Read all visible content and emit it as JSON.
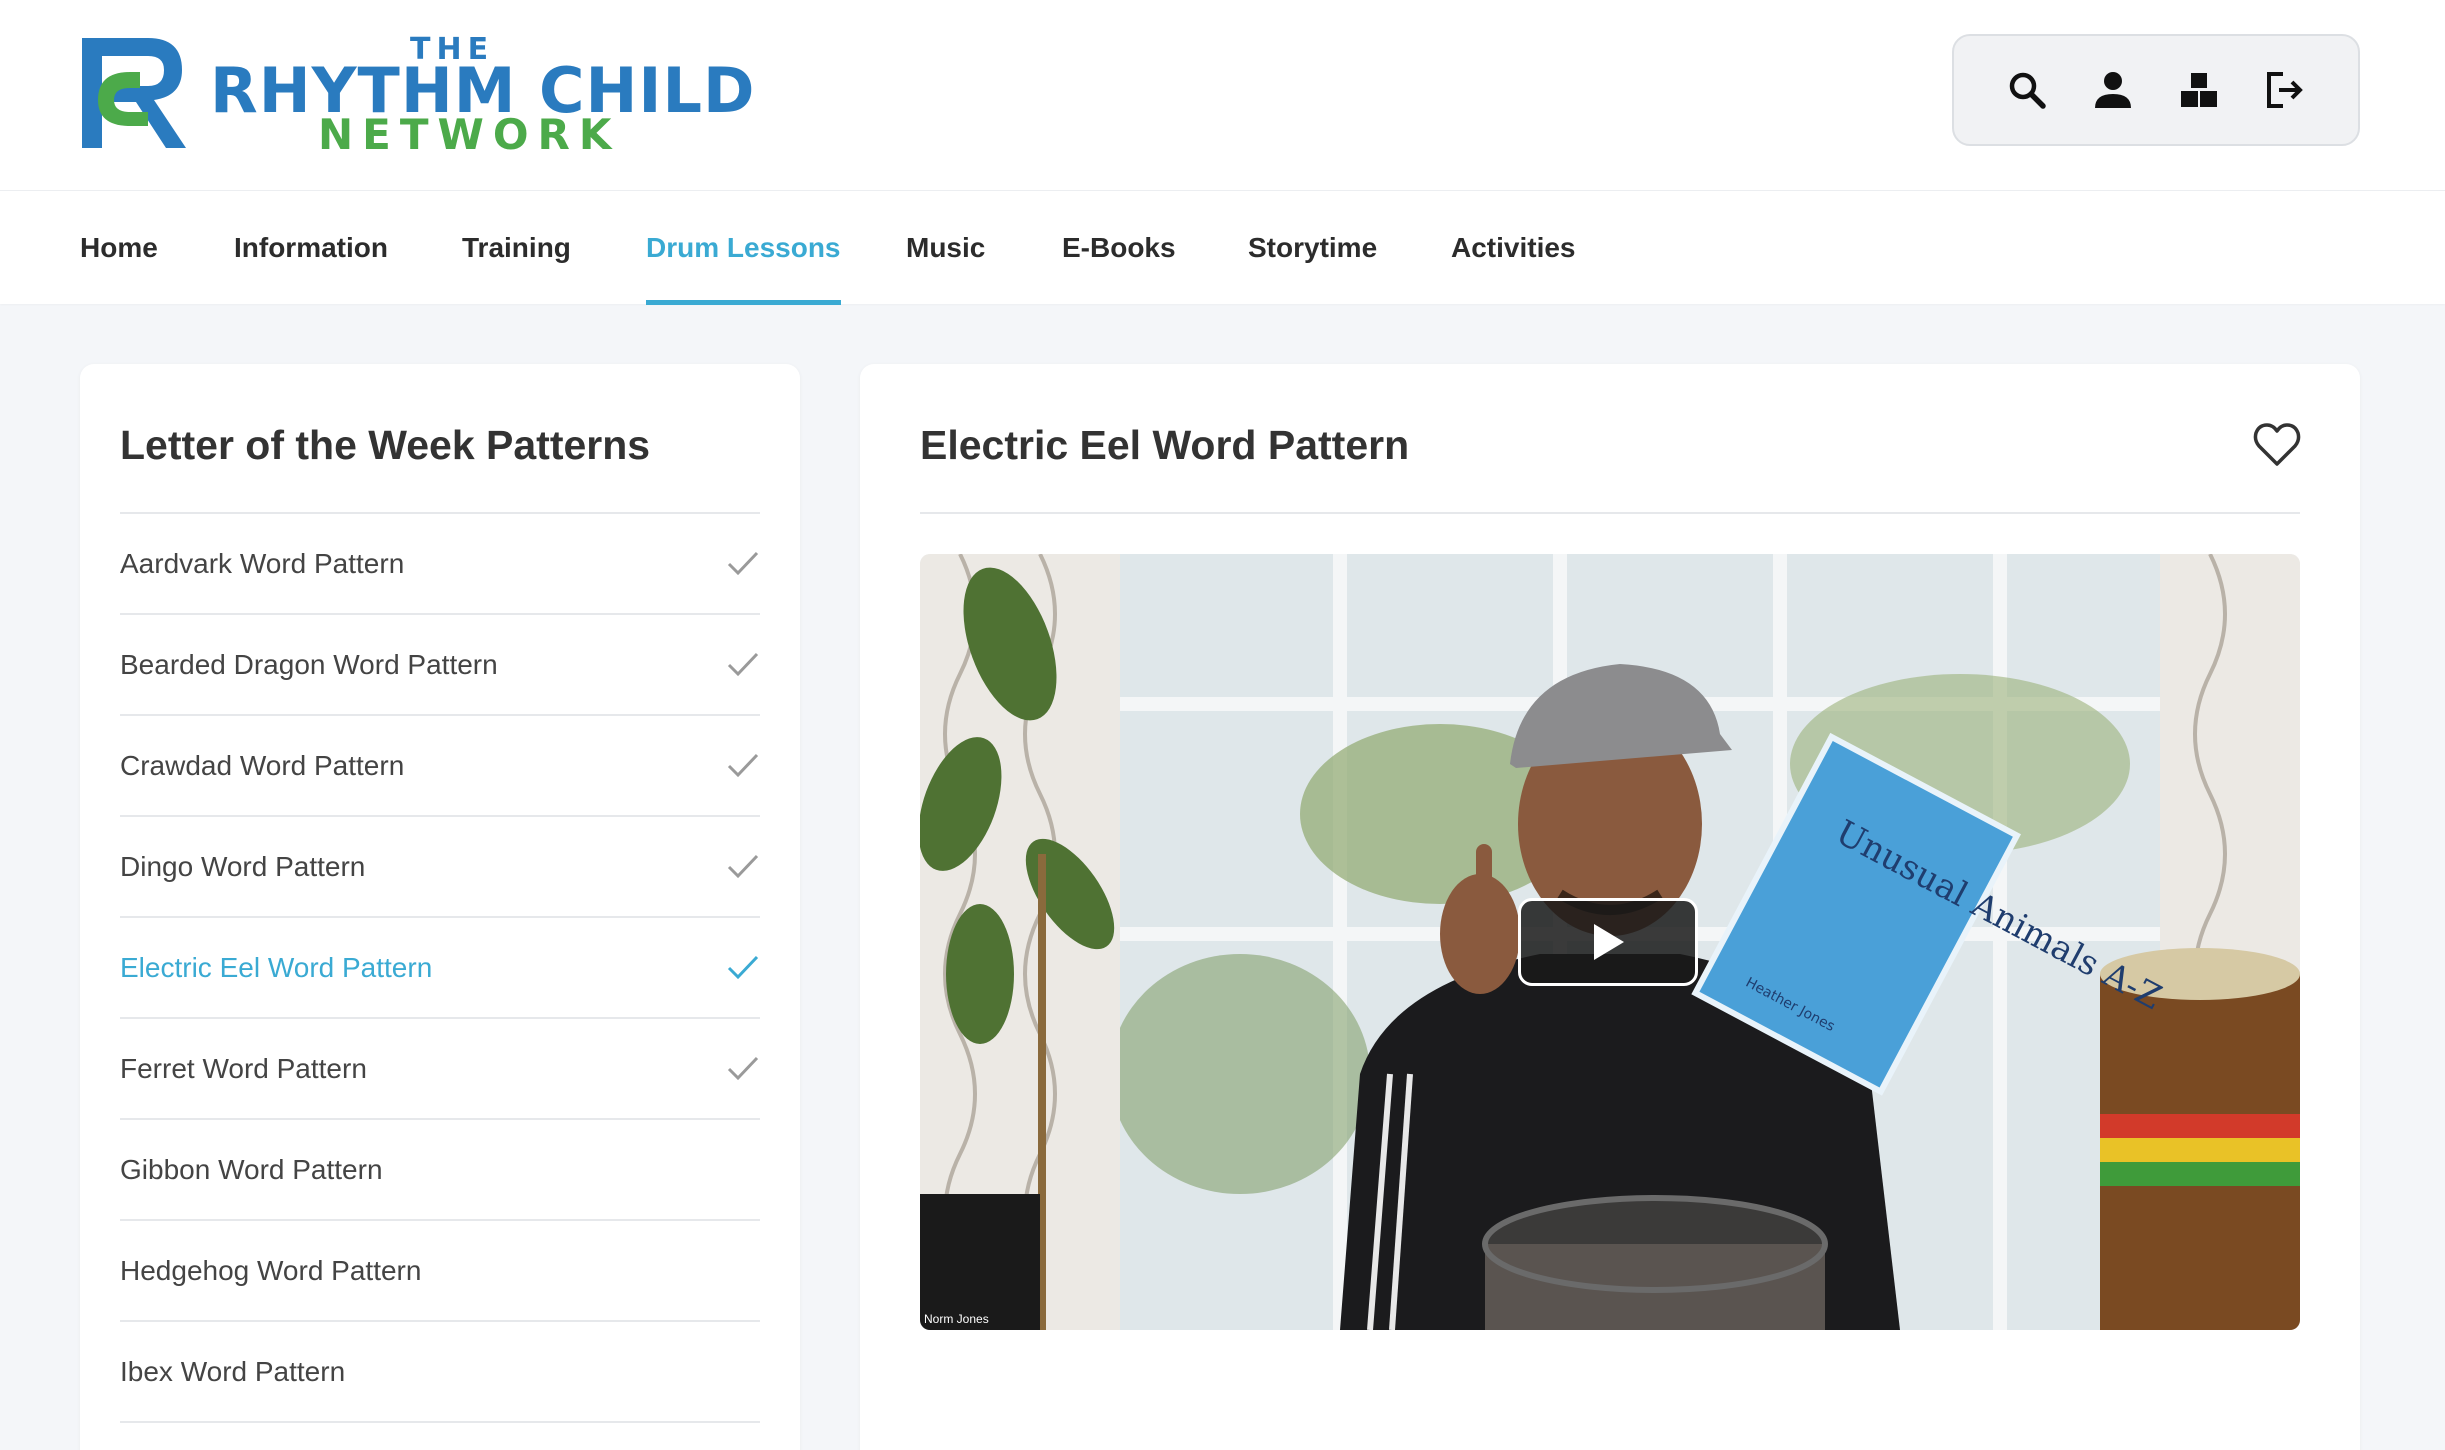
{
  "brand": {
    "the": "THE",
    "name": "RHYTHM CHILD",
    "sub": "NETWORK",
    "blue": "#2a7bbf",
    "green": "#4caa4a"
  },
  "header_icons": [
    "search-icon",
    "user-icon",
    "blocks-icon",
    "logout-icon"
  ],
  "nav": {
    "items": [
      {
        "label": "Home"
      },
      {
        "label": "Information"
      },
      {
        "label": "Training"
      },
      {
        "label": "Drum Lessons"
      },
      {
        "label": "Music"
      },
      {
        "label": "E-Books"
      },
      {
        "label": "Storytime"
      },
      {
        "label": "Activities"
      }
    ],
    "active_index": 3,
    "active_color": "#3aaad3"
  },
  "sidebar": {
    "title": "Letter of the Week Patterns",
    "items": [
      {
        "label": "Aardvark Word Pattern",
        "completed": true
      },
      {
        "label": "Bearded Dragon Word Pattern",
        "completed": true
      },
      {
        "label": "Crawdad Word Pattern",
        "completed": true
      },
      {
        "label": "Dingo Word Pattern",
        "completed": true
      },
      {
        "label": "Electric Eel Word Pattern",
        "completed": true,
        "active": true
      },
      {
        "label": "Ferret Word Pattern",
        "completed": true
      },
      {
        "label": "Gibbon Word Pattern",
        "completed": false
      },
      {
        "label": "Hedgehog Word Pattern",
        "completed": false
      },
      {
        "label": "Ibex Word Pattern",
        "completed": false
      }
    ]
  },
  "lesson": {
    "title": "Electric Eel Word Pattern",
    "favorite_icon": "heart-outline-icon",
    "video": {
      "caption": "Norm Jones",
      "book_title": "Unusual Animals A-Z",
      "book_author": "Heather Jones",
      "play_icon": "play-icon"
    }
  }
}
